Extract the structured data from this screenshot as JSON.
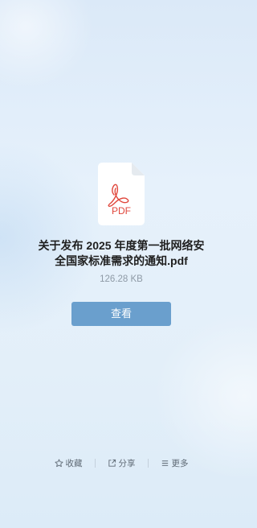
{
  "file": {
    "name_line1": "关于发布 2025 年度第一批网络安",
    "name_line2": "全国家标准需求的通知.pdf",
    "size": "126.28 KB",
    "icon": "pdf-file-icon",
    "icon_label": "PDF"
  },
  "actions": {
    "view_label": "查看",
    "favorite": {
      "label": "收藏",
      "icon": "star-icon"
    },
    "share": {
      "label": "分享",
      "icon": "share-icon"
    },
    "more": {
      "label": "更多",
      "icon": "menu-icon"
    }
  },
  "colors": {
    "button": "#6a9fcd",
    "pdf_red": "#e0473c"
  }
}
